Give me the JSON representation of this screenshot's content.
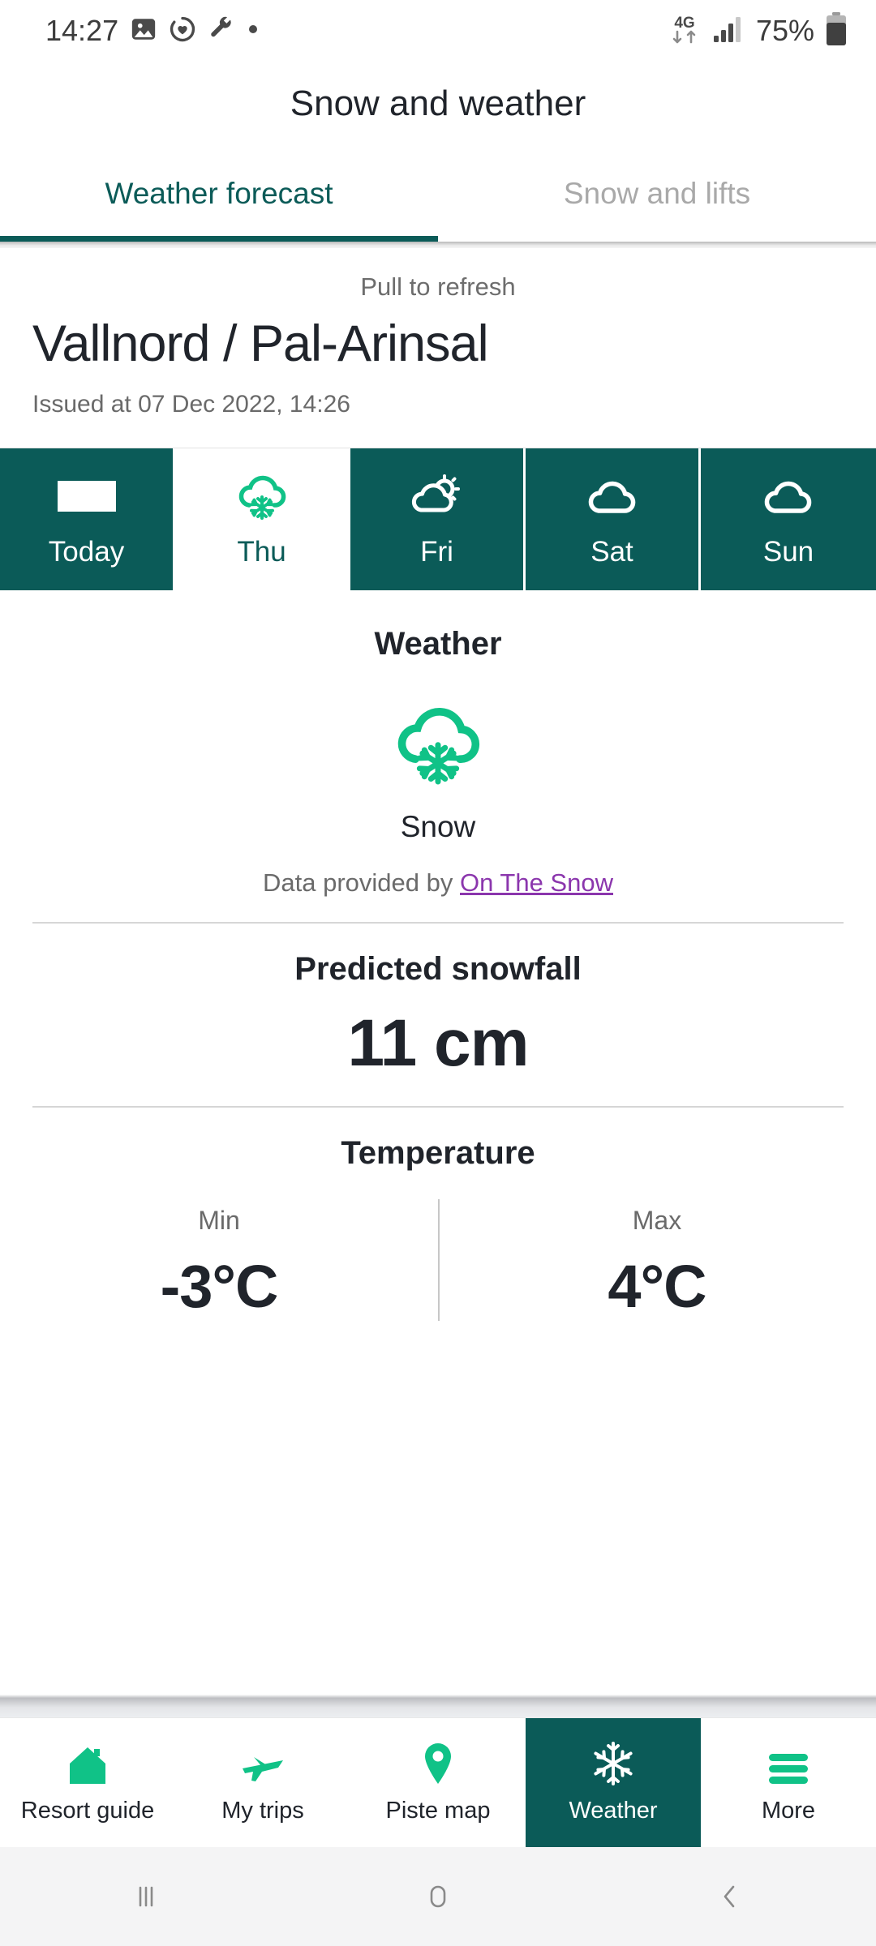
{
  "status_bar": {
    "time": "14:27",
    "icons": [
      "image-icon",
      "heart-refresh-icon",
      "wrench-icon",
      "dot-icon"
    ],
    "network_type": "4G",
    "battery_percent": "75%"
  },
  "app": {
    "title": "Snow and weather"
  },
  "tabs": {
    "items": [
      {
        "label": "Weather forecast",
        "active": true
      },
      {
        "label": "Snow and lifts",
        "active": false
      }
    ]
  },
  "header": {
    "pull_to_refresh": "Pull to refresh",
    "resort": "Vallnord / Pal-Arinsal",
    "issued": "Issued at 07 Dec 2022, 14:26"
  },
  "days": [
    {
      "label": "Today",
      "icon": "placeholder-rect-icon",
      "selected": false
    },
    {
      "label": "Thu",
      "icon": "snow-cloud-icon",
      "selected": true
    },
    {
      "label": "Fri",
      "icon": "sun-cloud-icon",
      "selected": false
    },
    {
      "label": "Sat",
      "icon": "cloud-icon",
      "selected": false
    },
    {
      "label": "Sun",
      "icon": "cloud-icon",
      "selected": false
    }
  ],
  "weather": {
    "heading": "Weather",
    "icon": "snow-cloud-icon",
    "condition": "Snow",
    "attribution_prefix": "Data provided by ",
    "attribution_link": "On The Snow"
  },
  "snowfall": {
    "heading": "Predicted snowfall",
    "value": "11 cm"
  },
  "temperature": {
    "heading": "Temperature",
    "min_label": "Min",
    "min_value": "-3°C",
    "max_label": "Max",
    "max_value": "4°C"
  },
  "bottom_nav": [
    {
      "label": "Resort guide",
      "icon": "house-icon",
      "active": false
    },
    {
      "label": "My trips",
      "icon": "plane-icon",
      "active": false
    },
    {
      "label": "Piste map",
      "icon": "map-pin-icon",
      "active": false
    },
    {
      "label": "Weather",
      "icon": "snowflake-icon",
      "active": true
    },
    {
      "label": "More",
      "icon": "hamburger-icon",
      "active": false
    }
  ],
  "system_nav": {
    "recents": "recents-icon",
    "home": "home-icon",
    "back": "back-icon"
  },
  "colors": {
    "teal_dark": "#0b5b58",
    "green_accent": "#10c287",
    "link_purple": "#8b36ad",
    "text_dark": "#20242b",
    "text_muted": "#6a6a6a"
  }
}
